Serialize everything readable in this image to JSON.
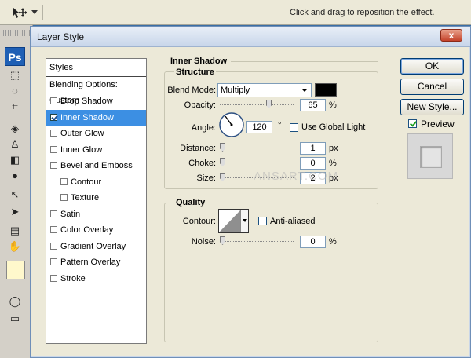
{
  "options_bar": {
    "tool_icon": "move-tool-icon",
    "hint": "Click and drag to reposition the effect."
  },
  "toolbox": {
    "logo": "Ps"
  },
  "dialog": {
    "title": "Layer Style",
    "close_label": "x",
    "styles_panel": {
      "header": "Styles",
      "blending": "Blending Options: Custom",
      "items": [
        {
          "label": "Drop Shadow",
          "checked": false,
          "selected": false,
          "indent": false
        },
        {
          "label": "Inner Shadow",
          "checked": true,
          "selected": true,
          "indent": false
        },
        {
          "label": "Outer Glow",
          "checked": false,
          "selected": false,
          "indent": false
        },
        {
          "label": "Inner Glow",
          "checked": false,
          "selected": false,
          "indent": false
        },
        {
          "label": "Bevel and Emboss",
          "checked": false,
          "selected": false,
          "indent": false
        },
        {
          "label": "Contour",
          "checked": false,
          "selected": false,
          "indent": true
        },
        {
          "label": "Texture",
          "checked": false,
          "selected": false,
          "indent": true
        },
        {
          "label": "Satin",
          "checked": false,
          "selected": false,
          "indent": false
        },
        {
          "label": "Color Overlay",
          "checked": false,
          "selected": false,
          "indent": false
        },
        {
          "label": "Gradient Overlay",
          "checked": false,
          "selected": false,
          "indent": false
        },
        {
          "label": "Pattern Overlay",
          "checked": false,
          "selected": false,
          "indent": false
        },
        {
          "label": "Stroke",
          "checked": false,
          "selected": false,
          "indent": false
        }
      ]
    },
    "inner_shadow": {
      "title": "Inner Shadow",
      "structure": {
        "title": "Structure",
        "blend_mode_label": "Blend Mode:",
        "blend_mode_value": "Multiply",
        "shadow_color": "#000000",
        "opacity_label": "Opacity:",
        "opacity_value": "65",
        "opacity_unit": "%",
        "angle_label": "Angle:",
        "angle_value": "120",
        "angle_unit": "°",
        "global_light_label": "Use Global Light",
        "global_light_checked": false,
        "distance_label": "Distance:",
        "distance_value": "1",
        "distance_unit": "px",
        "choke_label": "Choke:",
        "choke_value": "0",
        "choke_unit": "%",
        "size_label": "Size:",
        "size_value": "2",
        "size_unit": "px"
      },
      "quality": {
        "title": "Quality",
        "contour_label": "Contour:",
        "anti_aliased_label": "Anti-aliased",
        "anti_aliased_checked": false,
        "noise_label": "Noise:",
        "noise_value": "0",
        "noise_unit": "%"
      }
    },
    "buttons": {
      "ok": "OK",
      "cancel": "Cancel",
      "new_style": "New Style...",
      "preview_label": "Preview",
      "preview_checked": true
    },
    "watermark": "ANSART.COM"
  }
}
